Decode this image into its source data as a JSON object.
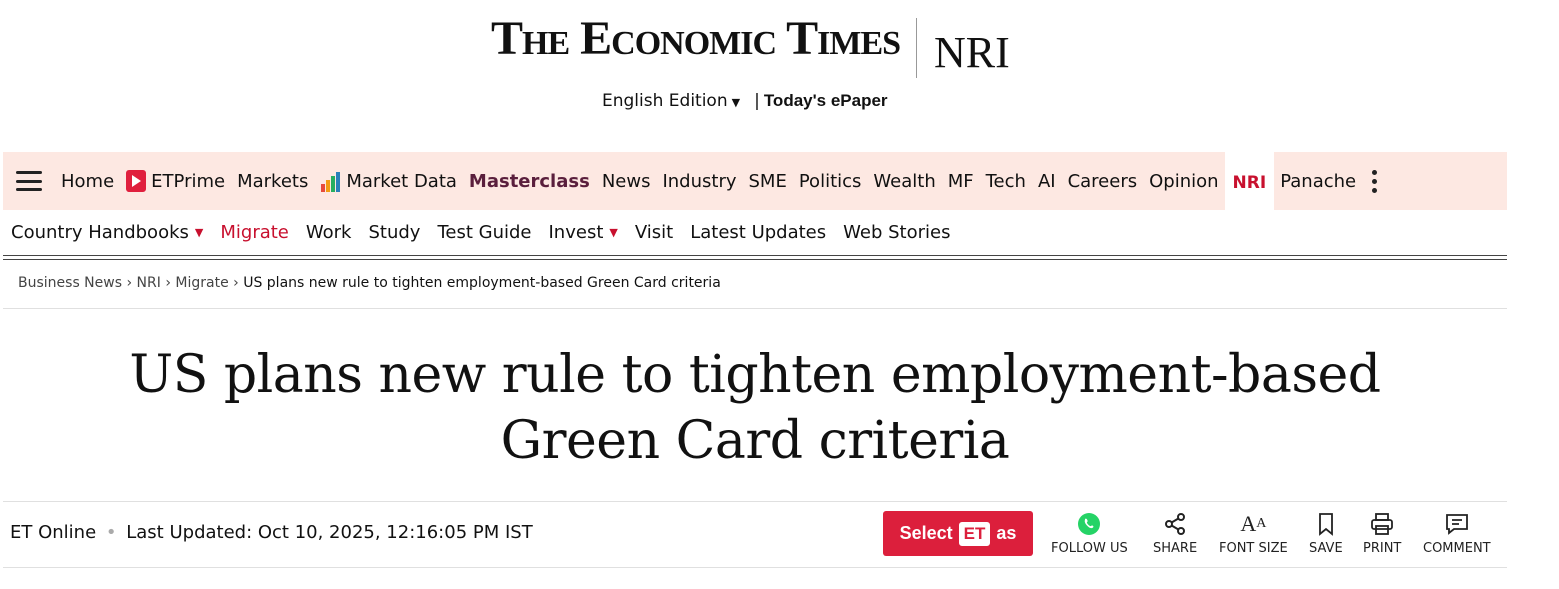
{
  "masthead": {
    "logo_text": "The Economic Times",
    "section": "NRI",
    "edition": "English Edition",
    "separator": "|",
    "epaper": "Today's ePaper"
  },
  "main_nav": {
    "items": [
      {
        "label": "Home"
      },
      {
        "label": "ETPrime",
        "icon": "prime-play-icon"
      },
      {
        "label": "Markets"
      },
      {
        "label": "Market Data",
        "icon": "bar-chart-icon"
      },
      {
        "label": "Masterclass",
        "style": "bold"
      },
      {
        "label": "News"
      },
      {
        "label": "Industry"
      },
      {
        "label": "SME"
      },
      {
        "label": "Politics"
      },
      {
        "label": "Wealth"
      },
      {
        "label": "MF"
      },
      {
        "label": "Tech"
      },
      {
        "label": "AI"
      },
      {
        "label": "Careers"
      },
      {
        "label": "Opinion"
      },
      {
        "label": "NRI",
        "active": true
      },
      {
        "label": "Panache"
      }
    ]
  },
  "sub_nav": {
    "items": [
      {
        "label": "Country Handbooks",
        "dropdown": true
      },
      {
        "label": "Migrate",
        "active": true
      },
      {
        "label": "Work"
      },
      {
        "label": "Study"
      },
      {
        "label": "Test Guide"
      },
      {
        "label": "Invest",
        "dropdown": true
      },
      {
        "label": "Visit"
      },
      {
        "label": "Latest Updates"
      },
      {
        "label": "Web Stories"
      }
    ]
  },
  "breadcrumb": {
    "items": [
      "Business News",
      "NRI",
      "Migrate"
    ],
    "separator": "›",
    "current": "US plans new rule to tighten employment-based Green Card criteria"
  },
  "article": {
    "headline_line1": "US plans new rule to tighten employment-based",
    "headline_line2": "Green Card criteria",
    "author": "ET Online",
    "bullet": "•",
    "updated": "Last Updated: Oct 10, 2025, 12:16:05 PM IST"
  },
  "toolbar": {
    "select_pre": "Select",
    "select_brand": "ET",
    "select_post": "as",
    "follow": "FOLLOW US",
    "share": "SHARE",
    "font_size": "FONT SIZE",
    "save": "SAVE",
    "print": "PRINT",
    "comment": "COMMENT"
  },
  "colors": {
    "nav_bg": "#fde8e2",
    "accent_red": "#c8102e",
    "select_button": "#dc1f3c",
    "masterclass": "#5a1e3c",
    "whatsapp": "#25d366"
  }
}
